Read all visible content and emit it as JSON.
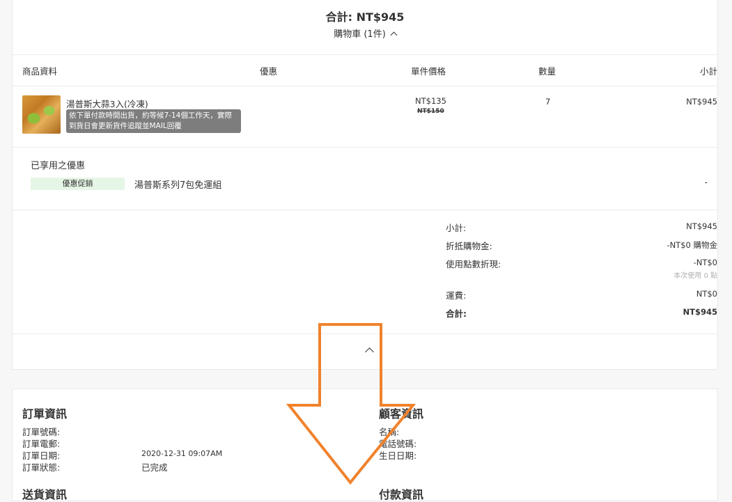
{
  "header": {
    "total_label": "合計:",
    "total_value": "NT$945",
    "cart_toggle": "購物車 (1件)"
  },
  "table": {
    "headers": [
      "商品資料",
      "優惠",
      "單件價格",
      "數量",
      "小計"
    ],
    "items": [
      {
        "name": "湯普斯大蒜3入(冷凍)",
        "note": "依下單付款時間出貨，約等候7-14個工作天，實際到貨日會更新貨件追蹤並MAIL回覆",
        "price": "NT$135",
        "original_price": "NT$150",
        "quantity": "7",
        "subtotal": "NT$945"
      }
    ]
  },
  "promotions": {
    "title": "已享用之優惠",
    "items": [
      {
        "badge": "優惠促銷",
        "name": "湯普斯系列7包免運組",
        "amount": "-"
      }
    ]
  },
  "summary": {
    "subtotal_label": "小計:",
    "subtotal_value": "NT$945",
    "credit_label": "折抵購物金:",
    "credit_value": "-NT$0 購物金",
    "points_label": "使用點數折現:",
    "points_value": "-NT$0",
    "points_note": "本次使用 0 點",
    "shipping_label": "運費:",
    "shipping_value": "NT$0",
    "total_label": "合計:",
    "total_value": "NT$945"
  },
  "order_info": {
    "title": "訂單資訊",
    "rows": [
      {
        "label": "訂單號碼:",
        "value": ""
      },
      {
        "label": "訂單電郵:",
        "value": ""
      },
      {
        "label": "訂單日期:",
        "value": "2020-12-31 09:07AM"
      },
      {
        "label": "訂單狀態:",
        "value": "已完成"
      }
    ]
  },
  "customer_info": {
    "title": "顧客資訊",
    "rows": [
      {
        "label": "名稱:",
        "value": ""
      },
      {
        "label": "電話號碼:",
        "value": ""
      },
      {
        "label": "生日日期:",
        "value": ""
      }
    ]
  },
  "lower_sections": {
    "shipping_title": "送貨資訊",
    "payment_title": "付款資訊"
  },
  "icons": {
    "cart_toggle": "chevron-up-icon",
    "collapse": "chevron-up-icon",
    "overlay": "down-arrow-overlay"
  },
  "colors": {
    "overlay_arrow": "#f0822c",
    "promo_badge_bg": "#e6f6e6",
    "note_bg": "#7d7d7d"
  }
}
